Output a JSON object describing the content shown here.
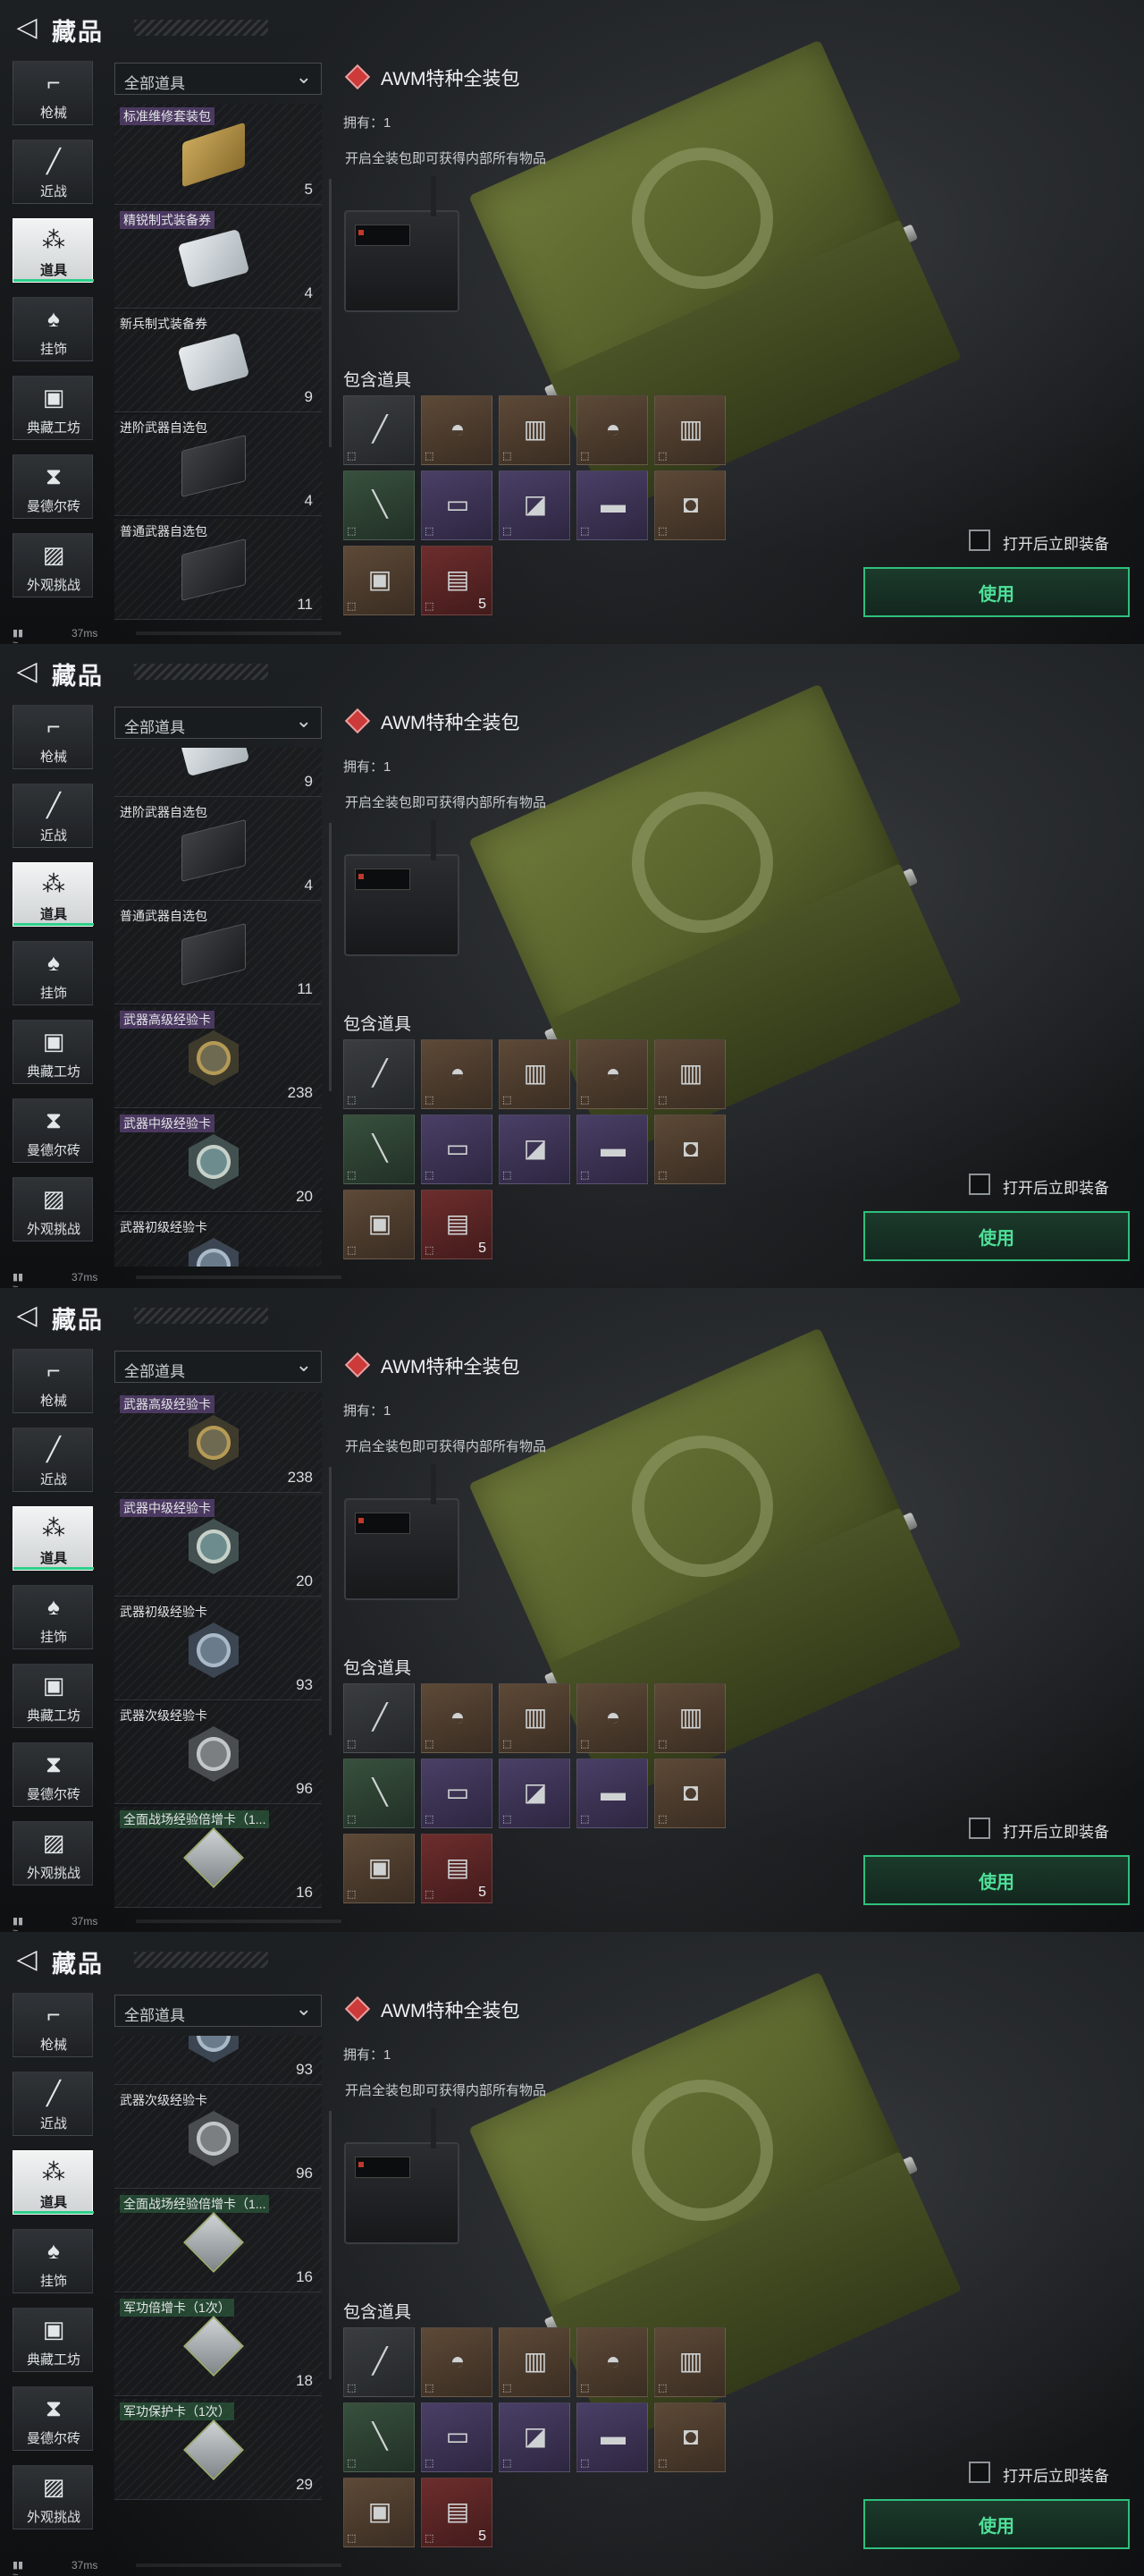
{
  "app": {
    "title": "藏品",
    "back_icon": "back-arrow-icon"
  },
  "sidebar": [
    {
      "label": "枪械",
      "icon": "rifle-icon",
      "glyph": "⌐",
      "active": false
    },
    {
      "label": "近战",
      "icon": "knife-icon",
      "glyph": "╱",
      "active": false
    },
    {
      "label": "道具",
      "icon": "items-icon",
      "glyph": "⁂",
      "active": true
    },
    {
      "label": "挂饰",
      "icon": "charm-icon",
      "glyph": "♠",
      "active": false
    },
    {
      "label": "典藏工坊",
      "icon": "workshop-icon",
      "glyph": "▣",
      "active": false
    },
    {
      "label": "曼德尔砖",
      "icon": "mandel-brick-icon",
      "glyph": "⧗",
      "active": false
    },
    {
      "label": "外观挑战",
      "icon": "appearance-challenge-icon",
      "glyph": "▨",
      "active": false
    }
  ],
  "filter": {
    "value": "全部道具",
    "icon": "chevron-down-icon"
  },
  "detail": {
    "title": "AWM特种全装包",
    "owned": "拥有：1",
    "description": "开启全装包即可获得内部所有物品",
    "contains_title": "包含道具",
    "contents": [
      {
        "icon": "sniper-rifle-icon",
        "tier": "gray",
        "glyph": "╱",
        "count": ""
      },
      {
        "icon": "helmet-icon",
        "tier": "brown",
        "glyph": "◓",
        "count": ""
      },
      {
        "icon": "vest-icon",
        "tier": "brown",
        "glyph": "▥",
        "count": ""
      },
      {
        "icon": "helmet-icon",
        "tier": "brown",
        "glyph": "◓",
        "count": ""
      },
      {
        "icon": "vest-icon",
        "tier": "brown",
        "glyph": "▥",
        "count": ""
      },
      {
        "icon": "syringe-icon",
        "tier": "green",
        "glyph": "╲",
        "count": ""
      },
      {
        "icon": "magazine-icon",
        "tier": "purple",
        "glyph": "▭",
        "count": ""
      },
      {
        "icon": "attachment-icon",
        "tier": "purple",
        "glyph": "◪",
        "count": ""
      },
      {
        "icon": "scope-icon",
        "tier": "purple",
        "glyph": "▬",
        "count": ""
      },
      {
        "icon": "gear-pack-icon",
        "tier": "brown",
        "glyph": "◘",
        "count": ""
      },
      {
        "icon": "medkit-icon",
        "tier": "brown",
        "glyph": "▣",
        "count": ""
      },
      {
        "icon": "ammo-box-icon",
        "tier": "red",
        "glyph": "▤",
        "count": "5"
      }
    ],
    "equip_label": "打开后立即装备",
    "use_label": "使用"
  },
  "status": {
    "ping": "37ms"
  },
  "panels": [
    {
      "items": [
        {
          "name": "标准维修套装包",
          "qty": "5",
          "shape": "kit",
          "tier": "purple"
        },
        {
          "name": "精锐制式装备券",
          "qty": "4",
          "shape": "bag",
          "tier": "purple"
        },
        {
          "name": "新兵制式装备券",
          "qty": "9",
          "shape": "bag",
          "tier": "none"
        },
        {
          "name": "进阶武器自选包",
          "qty": "4",
          "shape": "case",
          "tier": "none"
        },
        {
          "name": "普通武器自选包",
          "qty": "11",
          "shape": "case",
          "tier": "none"
        }
      ]
    },
    {
      "items": [
        {
          "name": "",
          "qty": "9",
          "shape": "bag",
          "tier": "none"
        },
        {
          "name": "进阶武器自选包",
          "qty": "4",
          "shape": "case",
          "tier": "none"
        },
        {
          "name": "普通武器自选包",
          "qty": "11",
          "shape": "case",
          "tier": "none"
        },
        {
          "name": "武器高级经验卡",
          "qty": "238",
          "shape": "card gold",
          "tier": "purple"
        },
        {
          "name": "武器中级经验卡",
          "qty": "20",
          "shape": "card teal",
          "tier": "purple"
        },
        {
          "name": "武器初级经验卡",
          "qty": "",
          "shape": "card blue",
          "tier": "none"
        }
      ]
    },
    {
      "items": [
        {
          "name": "武器高级经验卡",
          "qty": "238",
          "shape": "card gold",
          "tier": "purple"
        },
        {
          "name": "武器中级经验卡",
          "qty": "20",
          "shape": "card teal",
          "tier": "purple"
        },
        {
          "name": "武器初级经验卡",
          "qty": "93",
          "shape": "card blue",
          "tier": "none"
        },
        {
          "name": "武器次级经验卡",
          "qty": "96",
          "shape": "card gray",
          "tier": "none"
        },
        {
          "name": "全面战场经验倍增卡（1...",
          "qty": "16",
          "shape": "diamond",
          "tier": "green"
        }
      ]
    },
    {
      "items": [
        {
          "name": "",
          "qty": "93",
          "shape": "card blue",
          "tier": "none"
        },
        {
          "name": "武器次级经验卡",
          "qty": "96",
          "shape": "card gray",
          "tier": "none"
        },
        {
          "name": "全面战场经验倍增卡（1...",
          "qty": "16",
          "shape": "diamond",
          "tier": "green"
        },
        {
          "name": "军功倍增卡（1次）",
          "qty": "18",
          "shape": "diamond",
          "tier": "green"
        },
        {
          "name": "军功保护卡（1次）",
          "qty": "29",
          "shape": "diamond",
          "tier": "green"
        }
      ]
    }
  ]
}
